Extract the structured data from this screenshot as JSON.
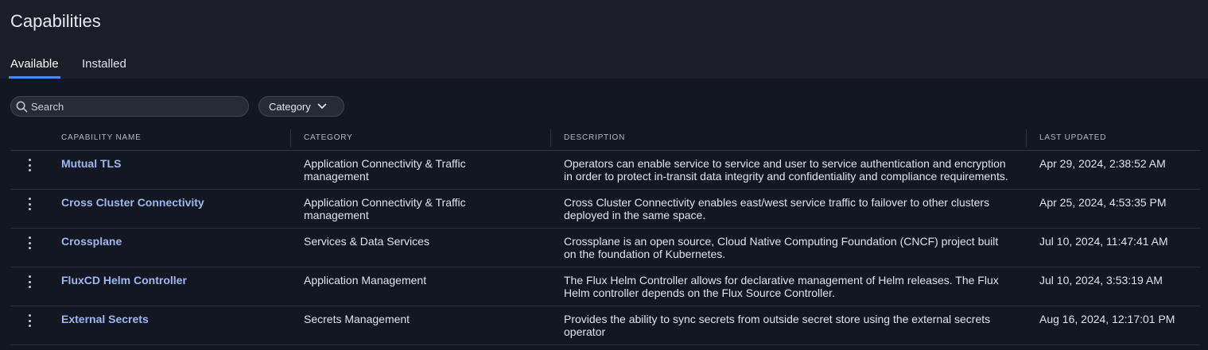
{
  "page": {
    "title": "Capabilities"
  },
  "tabs": [
    {
      "label": "Available",
      "active": true
    },
    {
      "label": "Installed",
      "active": false
    }
  ],
  "filters": {
    "search_placeholder": "Search",
    "category_label": "Category"
  },
  "table": {
    "columns": [
      "CAPABILITY NAME",
      "CATEGORY",
      "DESCRIPTION",
      "LAST UPDATED"
    ],
    "rows": [
      {
        "name": "Mutual TLS",
        "category": "Application Connectivity & Traffic management",
        "description": "Operators can enable service to service and user to service authentication and encryption in order to protect in-transit data integrity and confidentiality and compliance requirements.",
        "last_updated": "Apr 29, 2024, 2:38:52 AM"
      },
      {
        "name": "Cross Cluster Connectivity",
        "category": "Application Connectivity & Traffic management",
        "description": "Cross Cluster Connectivity enables east/west service traffic to failover to other clusters deployed in the same space.",
        "last_updated": "Apr 25, 2024, 4:53:35 PM"
      },
      {
        "name": "Crossplane",
        "category": "Services & Data Services",
        "description": "Crossplane is an open source, Cloud Native Computing Foundation (CNCF) project built on the foundation of Kubernetes.",
        "last_updated": "Jul 10, 2024, 11:47:41 AM"
      },
      {
        "name": "FluxCD Helm Controller",
        "category": "Application Management",
        "description": "The Flux Helm Controller allows for declarative management of Helm releases. The Flux Helm controller depends on the Flux Source Controller.",
        "last_updated": "Jul 10, 2024, 3:53:19 AM"
      },
      {
        "name": "External Secrets",
        "category": "Secrets Management",
        "description": "Provides the ability to sync secrets from outside secret store using the external secrets operator",
        "last_updated": "Aug 16, 2024, 12:17:01 PM"
      }
    ]
  },
  "colors": {
    "background": "#121721",
    "header_background": "#1b1e29",
    "accent": "#4a8de6",
    "link": "#9db8f0"
  }
}
